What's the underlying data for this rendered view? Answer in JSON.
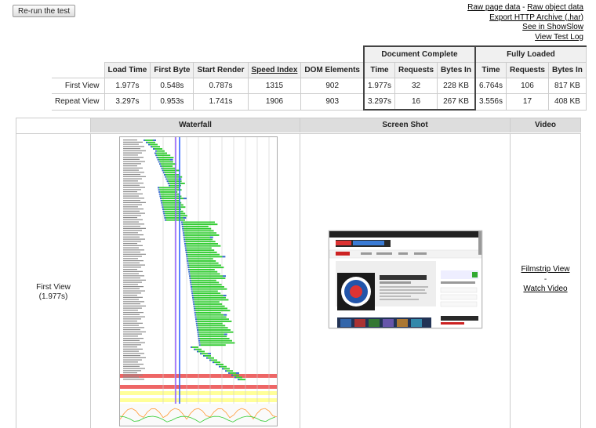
{
  "toolbar": {
    "rerun_label": "Re-run the test"
  },
  "links": {
    "raw_page": "Raw page data",
    "sep": " - ",
    "raw_object": "Raw object data",
    "export_har": "Export HTTP Archive (.har)",
    "showslow": "See in ShowSlow",
    "view_log": "View Test Log"
  },
  "results": {
    "group_doc": "Document Complete",
    "group_full": "Fully Loaded",
    "headers": [
      "Load Time",
      "First Byte",
      "Start Render",
      "Speed Index",
      "DOM Elements",
      "Time",
      "Requests",
      "Bytes In",
      "Time",
      "Requests",
      "Bytes In"
    ],
    "rows": [
      {
        "label": "First View",
        "cells": [
          "1.977s",
          "0.548s",
          "0.787s",
          "1315",
          "902",
          "1.977s",
          "32",
          "228 KB",
          "6.764s",
          "106",
          "817 KB"
        ]
      },
      {
        "label": "Repeat View",
        "cells": [
          "3.297s",
          "0.953s",
          "1.741s",
          "1906",
          "903",
          "3.297s",
          "16",
          "267 KB",
          "3.556s",
          "17",
          "408 KB"
        ]
      }
    ]
  },
  "panels": {
    "waterfall": "Waterfall",
    "screenshot": "Screen Shot",
    "video": "Video",
    "first_view_label": "First View",
    "first_view_time": "(1.977s)",
    "filmstrip": "Filmstrip View",
    "dash": "-",
    "watch_video": "Watch Video"
  },
  "colors": {
    "green": "#33cc33",
    "blue": "#3366cc",
    "purple": "#9966ff",
    "red": "#ee6666",
    "yellow": "#ffff99",
    "orange": "#ff9933"
  }
}
